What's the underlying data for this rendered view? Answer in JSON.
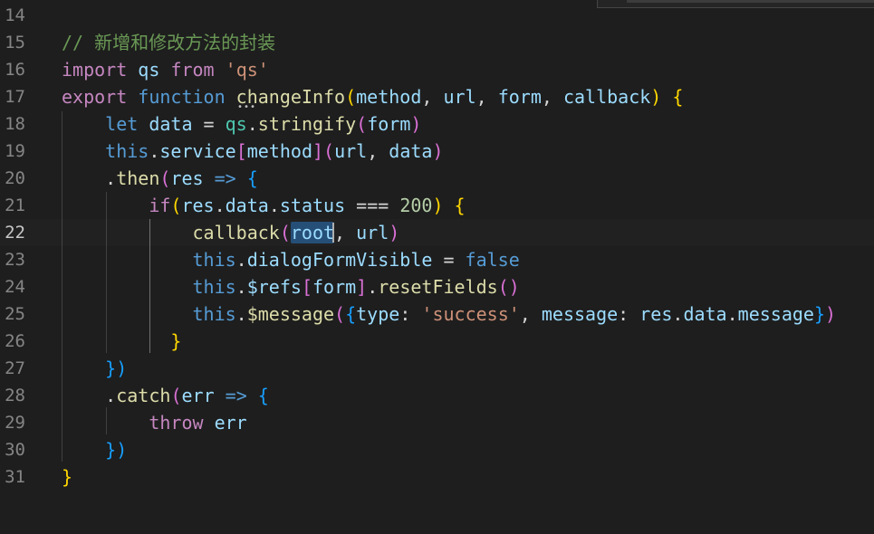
{
  "colors": {
    "background": "#1e1e1e",
    "line_number": "#858585",
    "line_number_active": "#c6c6c6",
    "comment": "#6a9955",
    "keyword_control": "#c586c0",
    "keyword": "#569cd6",
    "function": "#dcdcaa",
    "variable": "#9cdcfe",
    "namespace": "#4ec9b0",
    "string": "#ce9178",
    "number": "#b5cea8",
    "operator": "#d4d4d4",
    "bracket_gold": "#ffd700",
    "bracket_purple": "#da70d6",
    "bracket_blue": "#179fff",
    "selection": "#264f78"
  },
  "editor": {
    "cursor_icon": "text-cursor-icon",
    "lines": [
      {
        "number": "14",
        "tokens": []
      },
      {
        "number": "15",
        "tokens": [
          {
            "t": "// 新增和修改方法的封装",
            "c": "comment"
          }
        ]
      },
      {
        "number": "16",
        "tokens": [
          {
            "t": "import",
            "c": "keyword_control"
          },
          {
            "t": " ",
            "c": "operator"
          },
          {
            "t": "qs",
            "c": "variable"
          },
          {
            "t": " ",
            "c": "operator"
          },
          {
            "t": "from",
            "c": "keyword_control"
          },
          {
            "t": " ",
            "c": "operator"
          },
          {
            "t": "'qs'",
            "c": "string"
          }
        ]
      },
      {
        "number": "17",
        "tokens": [
          {
            "t": "export",
            "c": "keyword_control"
          },
          {
            "t": " ",
            "c": "operator"
          },
          {
            "t": "function",
            "c": "keyword"
          },
          {
            "t": " ",
            "c": "operator"
          },
          {
            "t": "changeInfo",
            "c": "function"
          },
          {
            "t": "(",
            "c": "bracket_gold"
          },
          {
            "t": "method",
            "c": "variable"
          },
          {
            "t": ", ",
            "c": "operator"
          },
          {
            "t": "url",
            "c": "variable"
          },
          {
            "t": ", ",
            "c": "operator"
          },
          {
            "t": "form",
            "c": "variable"
          },
          {
            "t": ", ",
            "c": "operator"
          },
          {
            "t": "callback",
            "c": "variable"
          },
          {
            "t": ")",
            "c": "bracket_gold"
          },
          {
            "t": " ",
            "c": "operator"
          },
          {
            "t": "{",
            "c": "bracket_gold"
          }
        ]
      },
      {
        "number": "18",
        "tokens": [
          {
            "t": "    ",
            "c": "operator"
          },
          {
            "t": "let",
            "c": "keyword"
          },
          {
            "t": " ",
            "c": "operator"
          },
          {
            "t": "data",
            "c": "variable"
          },
          {
            "t": " = ",
            "c": "operator"
          },
          {
            "t": "qs",
            "c": "namespace"
          },
          {
            "t": ".",
            "c": "operator"
          },
          {
            "t": "stringify",
            "c": "function"
          },
          {
            "t": "(",
            "c": "bracket_purple"
          },
          {
            "t": "form",
            "c": "variable"
          },
          {
            "t": ")",
            "c": "bracket_purple"
          }
        ]
      },
      {
        "number": "19",
        "tokens": [
          {
            "t": "    ",
            "c": "operator"
          },
          {
            "t": "this",
            "c": "keyword"
          },
          {
            "t": ".",
            "c": "operator"
          },
          {
            "t": "service",
            "c": "variable"
          },
          {
            "t": "[",
            "c": "bracket_purple"
          },
          {
            "t": "method",
            "c": "variable"
          },
          {
            "t": "]",
            "c": "bracket_purple"
          },
          {
            "t": "(",
            "c": "bracket_purple"
          },
          {
            "t": "url",
            "c": "variable"
          },
          {
            "t": ", ",
            "c": "operator"
          },
          {
            "t": "data",
            "c": "variable"
          },
          {
            "t": ")",
            "c": "bracket_purple"
          }
        ]
      },
      {
        "number": "20",
        "tokens": [
          {
            "t": "    .",
            "c": "operator"
          },
          {
            "t": "then",
            "c": "function"
          },
          {
            "t": "(",
            "c": "bracket_purple"
          },
          {
            "t": "res",
            "c": "variable"
          },
          {
            "t": " ",
            "c": "operator"
          },
          {
            "t": "=>",
            "c": "keyword"
          },
          {
            "t": " ",
            "c": "operator"
          },
          {
            "t": "{",
            "c": "bracket_blue"
          }
        ]
      },
      {
        "number": "21",
        "tokens": [
          {
            "t": "        ",
            "c": "operator"
          },
          {
            "t": "if",
            "c": "keyword_control"
          },
          {
            "t": "(",
            "c": "bracket_gold"
          },
          {
            "t": "res",
            "c": "variable"
          },
          {
            "t": ".",
            "c": "operator"
          },
          {
            "t": "data",
            "c": "variable"
          },
          {
            "t": ".",
            "c": "operator"
          },
          {
            "t": "status",
            "c": "variable"
          },
          {
            "t": " === ",
            "c": "operator"
          },
          {
            "t": "200",
            "c": "number"
          },
          {
            "t": ")",
            "c": "bracket_gold"
          },
          {
            "t": " ",
            "c": "operator"
          },
          {
            "t": "{",
            "c": "bracket_gold"
          }
        ]
      },
      {
        "number": "22",
        "active": true,
        "tokens": [
          {
            "t": "            ",
            "c": "operator"
          },
          {
            "t": "callback",
            "c": "function"
          },
          {
            "t": "(",
            "c": "bracket_purple"
          },
          {
            "t": "root",
            "c": "variable",
            "sel": true
          },
          {
            "t": ", ",
            "c": "operator"
          },
          {
            "t": "url",
            "c": "variable"
          },
          {
            "t": ")",
            "c": "bracket_purple"
          }
        ]
      },
      {
        "number": "23",
        "tokens": [
          {
            "t": "            ",
            "c": "operator"
          },
          {
            "t": "this",
            "c": "keyword"
          },
          {
            "t": ".",
            "c": "operator"
          },
          {
            "t": "dialogFormVisible",
            "c": "variable"
          },
          {
            "t": " = ",
            "c": "operator"
          },
          {
            "t": "false",
            "c": "keyword"
          }
        ]
      },
      {
        "number": "24",
        "tokens": [
          {
            "t": "            ",
            "c": "operator"
          },
          {
            "t": "this",
            "c": "keyword"
          },
          {
            "t": ".",
            "c": "operator"
          },
          {
            "t": "$refs",
            "c": "variable"
          },
          {
            "t": "[",
            "c": "bracket_purple"
          },
          {
            "t": "form",
            "c": "variable"
          },
          {
            "t": "]",
            "c": "bracket_purple"
          },
          {
            "t": ".",
            "c": "operator"
          },
          {
            "t": "resetFields",
            "c": "function"
          },
          {
            "t": "()",
            "c": "bracket_purple"
          }
        ]
      },
      {
        "number": "25",
        "tokens": [
          {
            "t": "            ",
            "c": "operator"
          },
          {
            "t": "this",
            "c": "keyword"
          },
          {
            "t": ".",
            "c": "operator"
          },
          {
            "t": "$message",
            "c": "function"
          },
          {
            "t": "(",
            "c": "bracket_purple"
          },
          {
            "t": "{",
            "c": "bracket_blue"
          },
          {
            "t": "type",
            "c": "variable"
          },
          {
            "t": ": ",
            "c": "operator"
          },
          {
            "t": "'success'",
            "c": "string"
          },
          {
            "t": ", ",
            "c": "operator"
          },
          {
            "t": "message",
            "c": "variable"
          },
          {
            "t": ": ",
            "c": "operator"
          },
          {
            "t": "res",
            "c": "variable"
          },
          {
            "t": ".",
            "c": "operator"
          },
          {
            "t": "data",
            "c": "variable"
          },
          {
            "t": ".",
            "c": "operator"
          },
          {
            "t": "message",
            "c": "variable"
          },
          {
            "t": "}",
            "c": "bracket_blue"
          },
          {
            "t": ")",
            "c": "bracket_purple"
          }
        ]
      },
      {
        "number": "26",
        "tokens": [
          {
            "t": "          ",
            "c": "operator"
          },
          {
            "t": "}",
            "c": "bracket_gold"
          }
        ]
      },
      {
        "number": "27",
        "tokens": [
          {
            "t": "    ",
            "c": "operator"
          },
          {
            "t": "})",
            "c": "bracket_blue"
          }
        ]
      },
      {
        "number": "28",
        "tokens": [
          {
            "t": "    .",
            "c": "operator"
          },
          {
            "t": "catch",
            "c": "function"
          },
          {
            "t": "(",
            "c": "bracket_purple"
          },
          {
            "t": "err",
            "c": "variable"
          },
          {
            "t": " ",
            "c": "operator"
          },
          {
            "t": "=>",
            "c": "keyword"
          },
          {
            "t": " ",
            "c": "operator"
          },
          {
            "t": "{",
            "c": "bracket_blue"
          }
        ]
      },
      {
        "number": "29",
        "tokens": [
          {
            "t": "        ",
            "c": "operator"
          },
          {
            "t": "throw",
            "c": "keyword_control"
          },
          {
            "t": " ",
            "c": "operator"
          },
          {
            "t": "err",
            "c": "variable"
          }
        ]
      },
      {
        "number": "30",
        "tokens": [
          {
            "t": "    ",
            "c": "operator"
          },
          {
            "t": "})",
            "c": "bracket_blue"
          }
        ]
      },
      {
        "number": "31",
        "tokens": [
          {
            "t": "}",
            "c": "bracket_gold"
          }
        ]
      }
    ]
  }
}
